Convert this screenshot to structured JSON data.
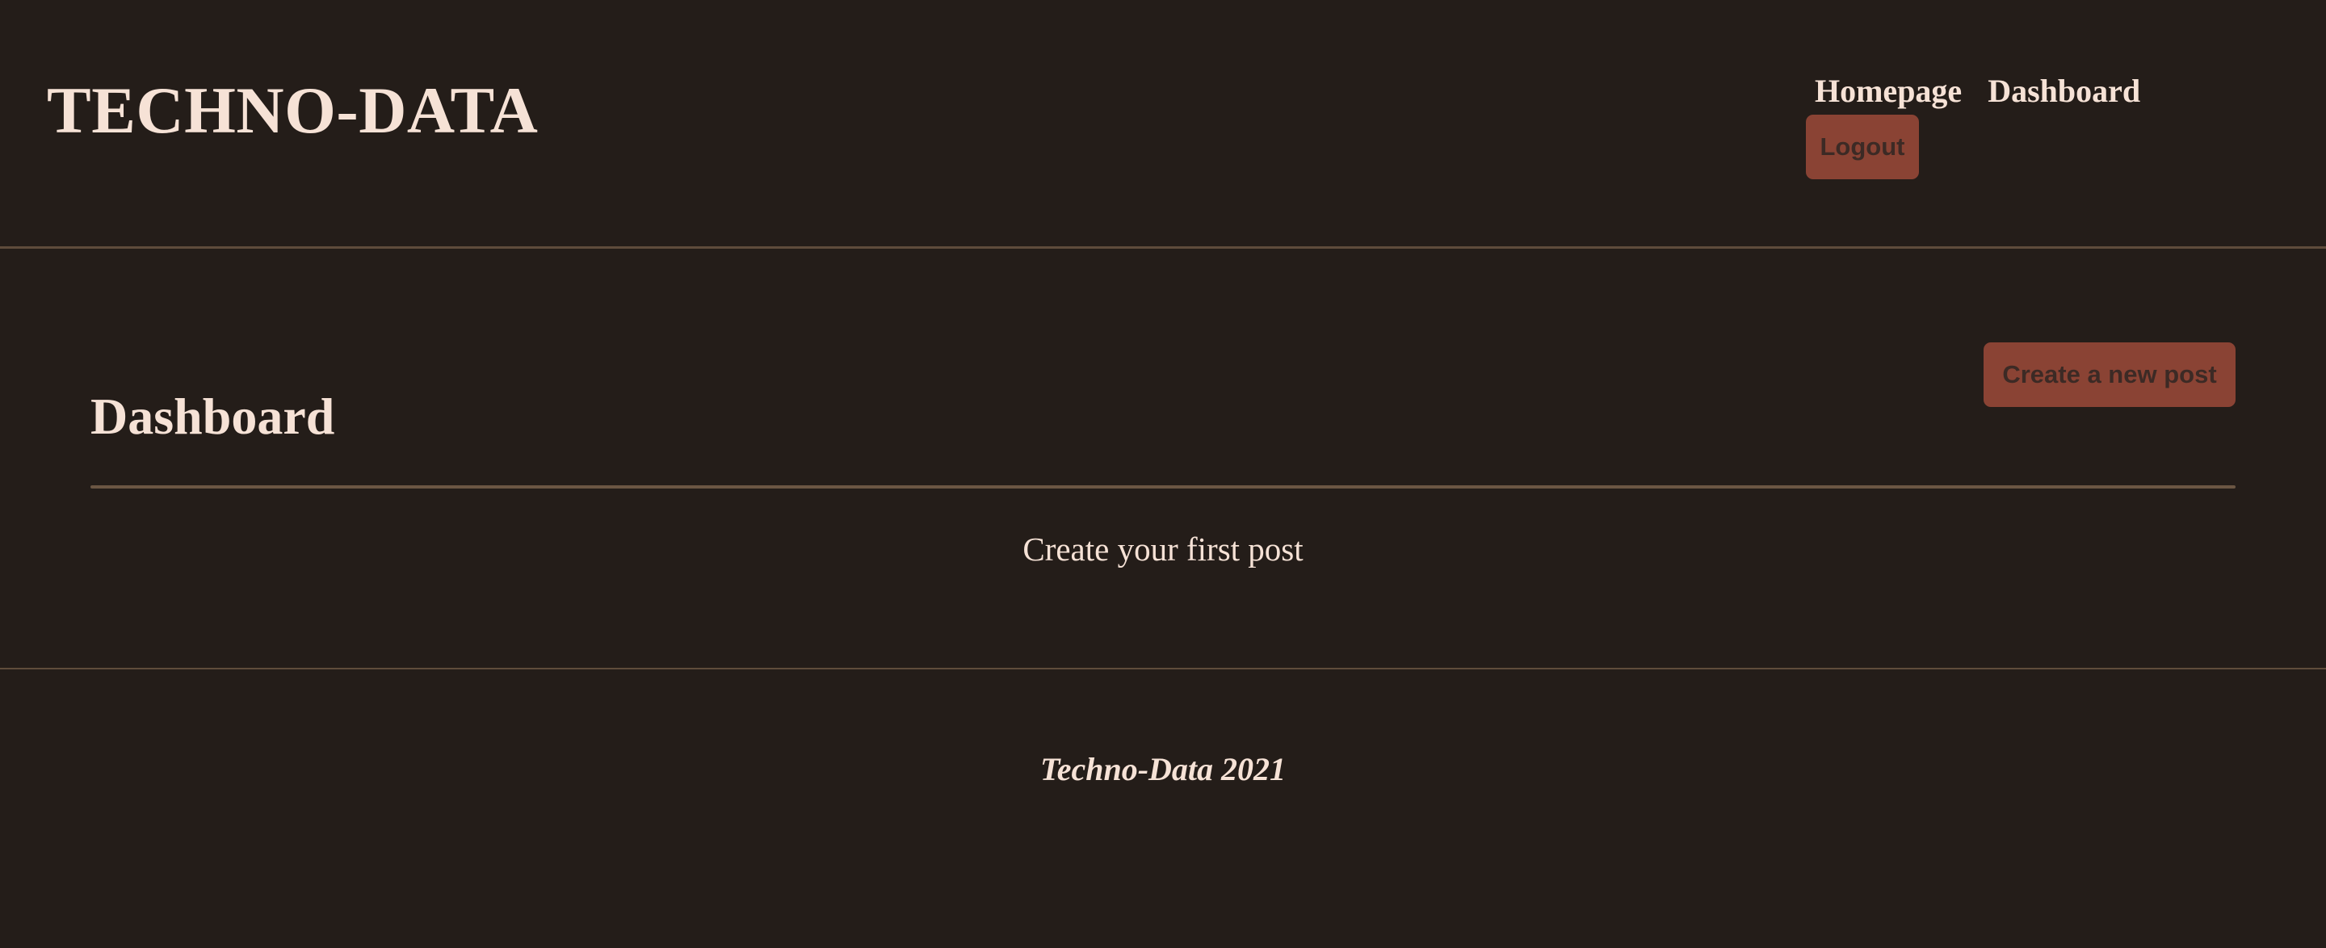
{
  "header": {
    "brand": "TECHNO-DATA",
    "nav": {
      "homepage_label": "Homepage",
      "dashboard_label": "Dashboard",
      "logout_label": "Logout"
    }
  },
  "main": {
    "title": "Dashboard",
    "new_post_label": "Create a new post",
    "empty_message": "Create your first post"
  },
  "footer": {
    "text": "Techno-Data 2021"
  },
  "colors": {
    "background": "#241d19",
    "text": "#f6e2d6",
    "button_bg": "#8a4334",
    "button_text": "#3c2a25",
    "rule": "#5f4c3b"
  }
}
